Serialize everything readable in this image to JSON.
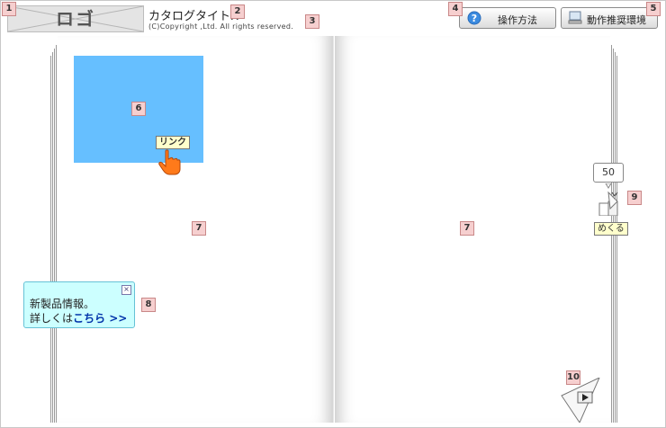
{
  "header": {
    "logo_text": "ロゴ",
    "title": "カタログタイトル",
    "copyright": "(C)Copyright ,Ltd. All rights reserved.",
    "help_button": "操作方法",
    "env_button": "動作推奨環境"
  },
  "markers": [
    "1",
    "2",
    "3",
    "4",
    "5",
    "6",
    "7",
    "8",
    "9",
    "10"
  ],
  "content": {
    "link_tip": "リンク"
  },
  "promo": {
    "line1": "新製品情報。",
    "line2_prefix": "詳しくは",
    "line2_link": "こちら >>"
  },
  "page_turn": {
    "page_number": "50",
    "label": "めくる"
  },
  "colors": {
    "link_area": "#66bfff",
    "promo_bg": "#ccffff",
    "marker_bg": "#f6cfcf",
    "cursor": "#ff7a1a"
  }
}
